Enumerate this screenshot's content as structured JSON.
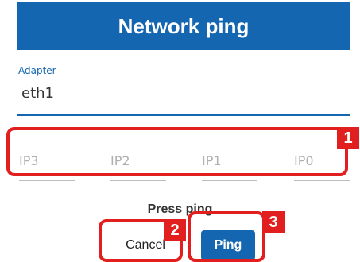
{
  "dialog": {
    "title": "Network ping"
  },
  "adapter": {
    "label": "Adapter",
    "value": "eth1"
  },
  "ip_fields": [
    {
      "placeholder": "IP3"
    },
    {
      "placeholder": "IP2"
    },
    {
      "placeholder": "IP1"
    },
    {
      "placeholder": "IP0"
    }
  ],
  "instruction": "Press ping",
  "buttons": {
    "cancel": "Cancel",
    "ping": "Ping"
  },
  "callouts": [
    "1",
    "2",
    "3"
  ],
  "colors": {
    "primary": "#1466b1",
    "callout": "#e11f1f"
  }
}
